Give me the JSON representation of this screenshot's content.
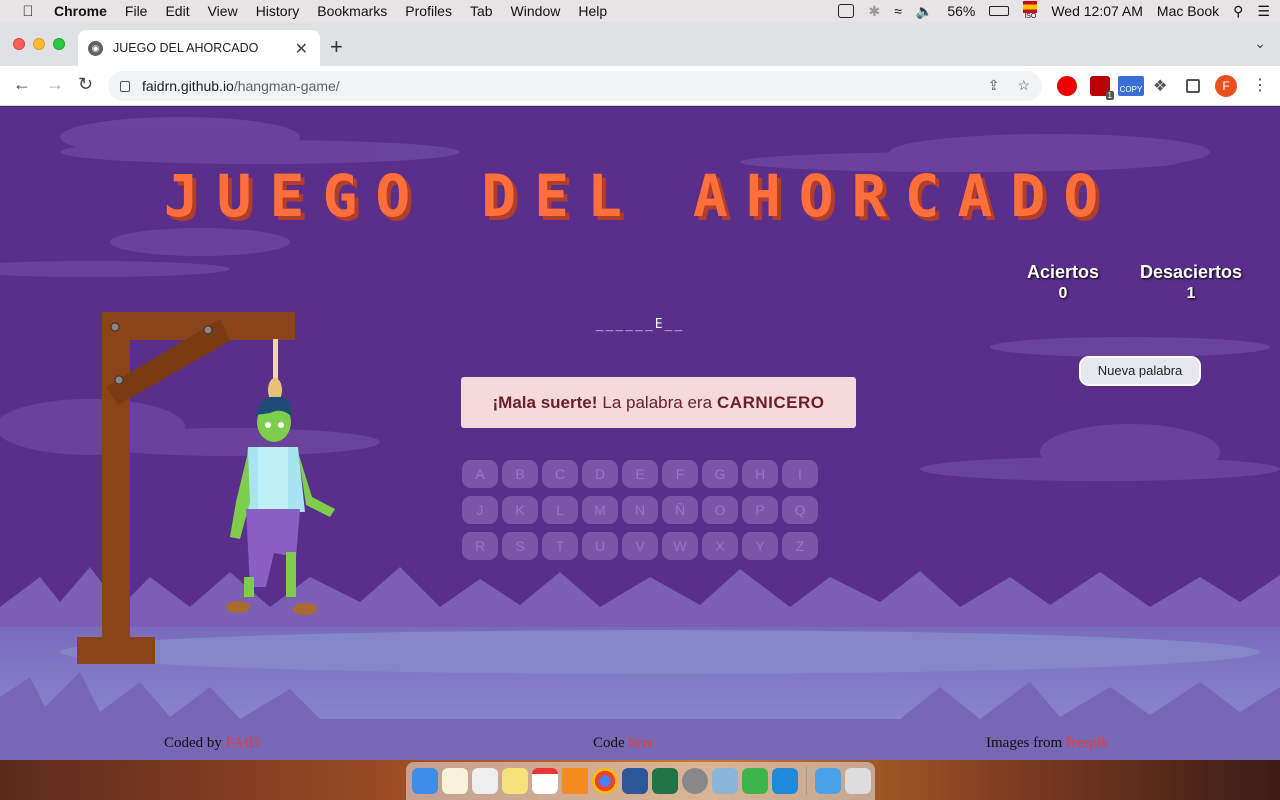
{
  "menubar": {
    "app": "Chrome",
    "items": [
      "File",
      "Edit",
      "View",
      "History",
      "Bookmarks",
      "Profiles",
      "Tab",
      "Window",
      "Help"
    ],
    "battery": "56%",
    "input_source": "ISO",
    "clock": "Wed 12:07 AM",
    "computer_name": "Mac Book"
  },
  "browser": {
    "tab_title": "JUEGO DEL AHORCADO",
    "url_host": "faidrn.github.io",
    "url_path": "/hangman-game/",
    "ext_copy_label": "COPY",
    "ext_badge": "1",
    "profile_initial": "F"
  },
  "game": {
    "title": "JUEGO DEL AHORCADO",
    "hits_label": "Aciertos",
    "hits_value": "0",
    "misses_label": "Desaciertos",
    "misses_value": "1",
    "word_display": "______E__",
    "new_word_button": "Nueva palabra",
    "message": {
      "exclaim": "¡Mala suerte!",
      "text": "La palabra era",
      "answer": "CARNICERO"
    },
    "keyboard_rows": [
      [
        "A",
        "B",
        "C",
        "D",
        "E",
        "F",
        "G",
        "H",
        "I"
      ],
      [
        "J",
        "K",
        "L",
        "M",
        "N",
        "Ñ",
        "O",
        "P",
        "Q"
      ],
      [
        "R",
        "S",
        "T",
        "U",
        "V",
        "W",
        "X",
        "Y",
        "Z"
      ]
    ]
  },
  "footer": {
    "coded_by_text": "Coded by",
    "coded_by_link": "FAID",
    "code_text": "Code",
    "code_link": "here",
    "images_text": "Images from",
    "images_link": "freepik"
  },
  "colors": {
    "page_bg": "#5a2f8c",
    "title": "#ff6f3c",
    "message_bg": "#f6d9dd",
    "key_bg": "#7d54a7",
    "link": "#e23b3b"
  }
}
